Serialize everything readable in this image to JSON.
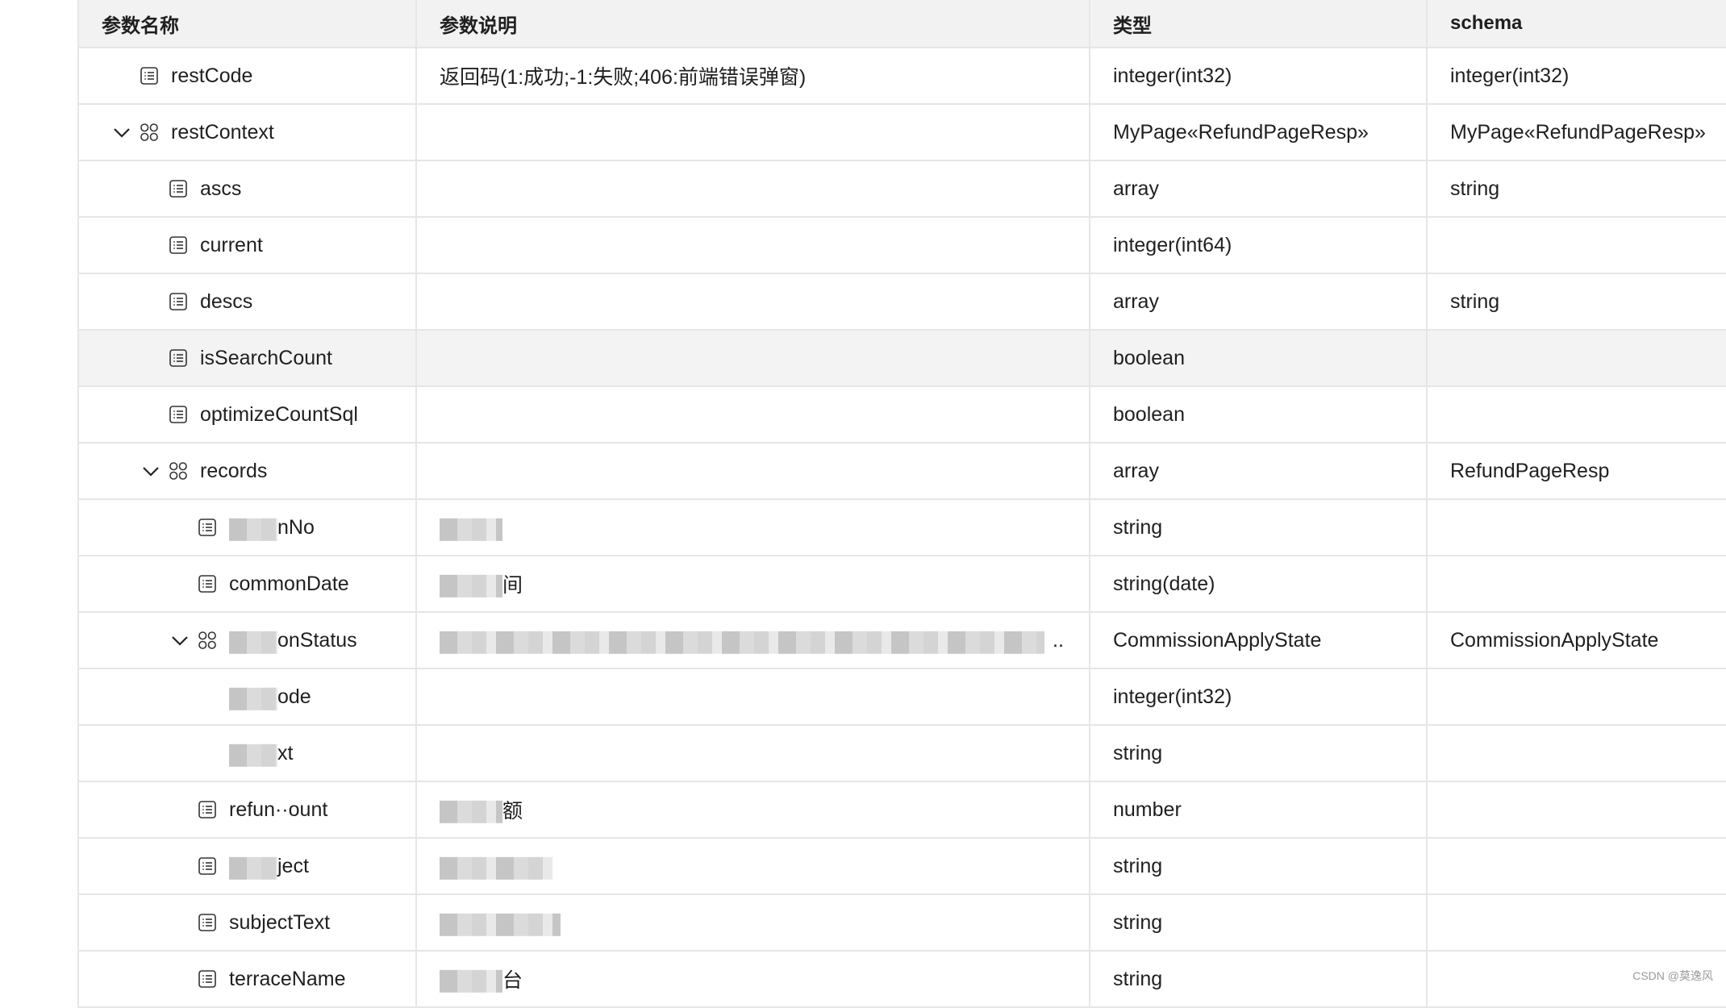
{
  "table": {
    "headers": {
      "name": "参数名称",
      "description": "参数说明",
      "type": "类型",
      "schema": "schema"
    },
    "rows": [
      {
        "name": "restCode",
        "level": 0,
        "icon": "list-icon",
        "expandable": false,
        "description": "返回码(1:成功;-1:失败;406:前端错误弹窗)",
        "type": "integer(int32)",
        "schema": "integer(int32)"
      },
      {
        "name": "restContext",
        "level": 0,
        "icon": "object-icon",
        "expandable": true,
        "expanded": true,
        "description": "",
        "type": "MyPage«RefundPageResp»",
        "schema": "MyPage«RefundPageResp»"
      },
      {
        "name": "ascs",
        "level": 1,
        "icon": "list-icon",
        "expandable": false,
        "description": "",
        "type": "array",
        "schema": "string"
      },
      {
        "name": "current",
        "level": 1,
        "icon": "list-icon",
        "expandable": false,
        "description": "",
        "type": "integer(int64)",
        "schema": ""
      },
      {
        "name": "descs",
        "level": 1,
        "icon": "list-icon",
        "expandable": false,
        "description": "",
        "type": "array",
        "schema": "string"
      },
      {
        "name": "isSearchCount",
        "level": 1,
        "icon": "list-icon",
        "expandable": false,
        "description": "",
        "type": "boolean",
        "schema": "",
        "hovered": true
      },
      {
        "name": "optimizeCountSql",
        "level": 1,
        "icon": "list-icon",
        "expandable": false,
        "description": "",
        "type": "boolean",
        "schema": ""
      },
      {
        "name": "records",
        "level": 1,
        "icon": "object-icon",
        "expandable": true,
        "expanded": true,
        "description": "",
        "type": "array",
        "schema": "RefundPageResp"
      },
      {
        "name": "nNo",
        "name_prefix_redacted": true,
        "level": 2,
        "icon": "list-icon",
        "expandable": false,
        "description": "",
        "description_redacted": true,
        "type": "string",
        "schema": ""
      },
      {
        "name": "commonDate",
        "name_visible": "com··onDate",
        "name_middle_redacted": true,
        "level": 2,
        "icon": "list-icon",
        "expandable": false,
        "description": "间",
        "description_redacted": true,
        "type": "string(date)",
        "schema": ""
      },
      {
        "name": "onStatus",
        "name_prefix_redacted": true,
        "level": 2,
        "icon": "object-icon",
        "expandable": true,
        "expanded": true,
        "description": "..",
        "description_redacted": true,
        "type": "CommissionApplyState",
        "schema": "CommissionApplyState"
      },
      {
        "name": "ode",
        "name_prefix_redacted": true,
        "level": 3,
        "icon": "",
        "expandable": false,
        "description": "",
        "type": "integer(int32)",
        "schema": ""
      },
      {
        "name": "xt",
        "name_prefix_redacted": true,
        "level": 3,
        "icon": "",
        "expandable": false,
        "description": "",
        "type": "string",
        "schema": ""
      },
      {
        "name": "refun··ount",
        "name_middle_redacted": true,
        "level": 2,
        "icon": "list-icon",
        "expandable": false,
        "description": "额",
        "description_redacted": true,
        "type": "number",
        "schema": ""
      },
      {
        "name": "ject",
        "name_prefix_redacted": true,
        "level": 2,
        "icon": "list-icon",
        "expandable": false,
        "description": "",
        "description_redacted": true,
        "type": "string",
        "schema": ""
      },
      {
        "name": "subjectText",
        "level": 2,
        "icon": "list-icon",
        "expandable": false,
        "description": "",
        "description_redacted": true,
        "type": "string",
        "schema": ""
      },
      {
        "name": "terraceName",
        "level": 2,
        "icon": "list-icon",
        "expandable": false,
        "description": "台",
        "description_redacted": true,
        "type": "string",
        "schema": ""
      }
    ]
  },
  "watermark": "CSDN @莫逸风",
  "colors": {
    "header_bg": "#f2f2f2",
    "border": "#e6e6e6",
    "hover_bg": "#f3f3f3",
    "text": "#1f1f1f"
  }
}
